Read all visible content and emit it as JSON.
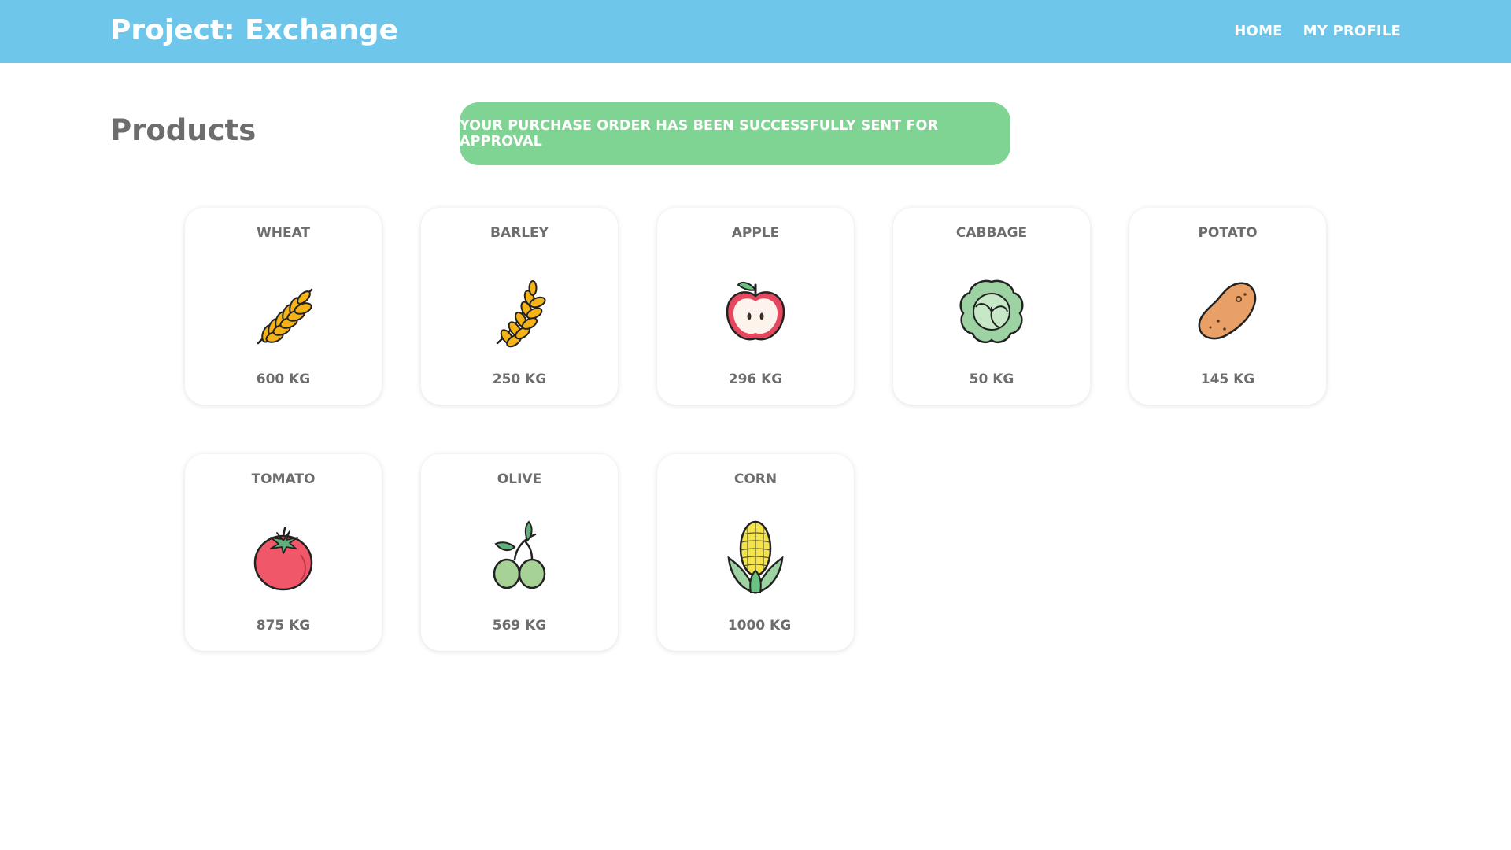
{
  "navbar": {
    "brand": "Project: Exchange",
    "links": [
      {
        "label": "HOME"
      },
      {
        "label": "MY PROFILE"
      }
    ]
  },
  "main": {
    "title": "Products",
    "alert": "YOUR PURCHASE ORDER HAS BEEN SUCCESSFULLY SENT FOR APPROVAL",
    "products": [
      {
        "name": "WHEAT",
        "quantity": "600 KG",
        "icon": "wheat-icon"
      },
      {
        "name": "BARLEY",
        "quantity": "250 KG",
        "icon": "barley-icon"
      },
      {
        "name": "APPLE",
        "quantity": "296 KG",
        "icon": "apple-icon"
      },
      {
        "name": "CABBAGE",
        "quantity": "50 KG",
        "icon": "cabbage-icon"
      },
      {
        "name": "POTATO",
        "quantity": "145 KG",
        "icon": "potato-icon"
      },
      {
        "name": "TOMATO",
        "quantity": "875 KG",
        "icon": "tomato-icon"
      },
      {
        "name": "OLIVE",
        "quantity": "569 KG",
        "icon": "olive-icon"
      },
      {
        "name": "CORN",
        "quantity": "1000 KG",
        "icon": "corn-icon"
      }
    ]
  },
  "colors": {
    "navbar": "#6ec6ea",
    "alert": "#7fd493",
    "text": "#6d6d6d"
  }
}
